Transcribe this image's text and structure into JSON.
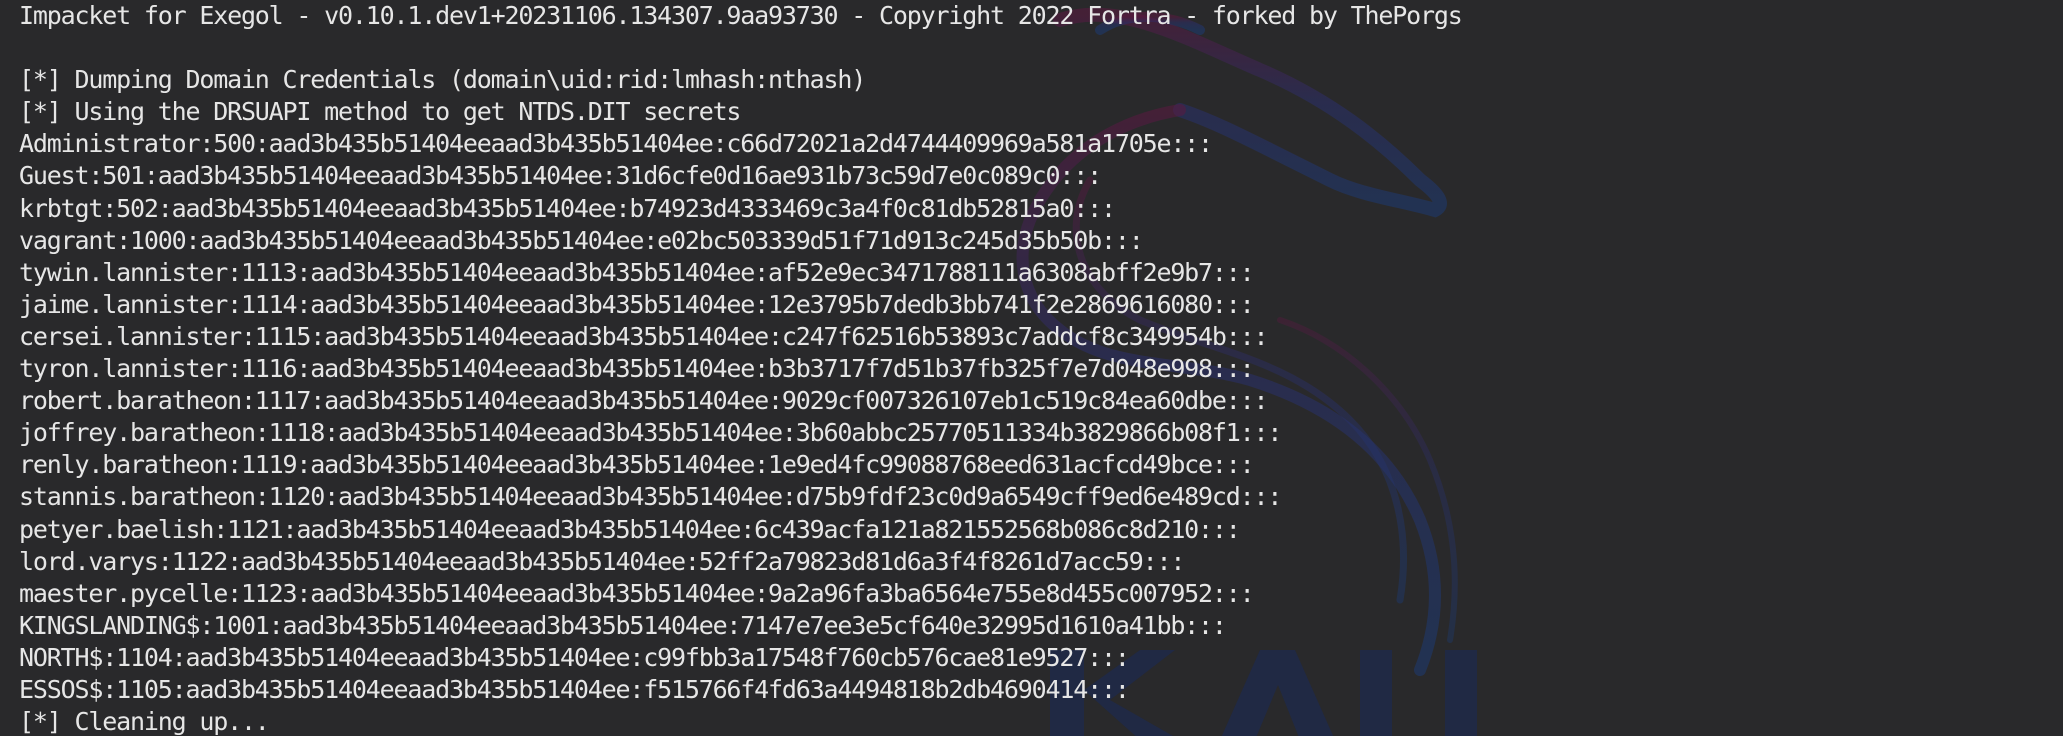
{
  "terminal": {
    "background_color": "#29292b",
    "text_color": "#e6e6e6",
    "wallpaper": "kali-dragon-logo",
    "wallpaper_text": "KALI",
    "lines": [
      "Impacket for Exegol - v0.10.1.dev1+20231106.134307.9aa93730 - Copyright 2022 Fortra - forked by ThePorgs",
      "",
      "[*] Dumping Domain Credentials (domain\\uid:rid:lmhash:nthash)",
      "[*] Using the DRSUAPI method to get NTDS.DIT secrets",
      "Administrator:500:aad3b435b51404eeaad3b435b51404ee:c66d72021a2d4744409969a581a1705e:::",
      "Guest:501:aad3b435b51404eeaad3b435b51404ee:31d6cfe0d16ae931b73c59d7e0c089c0:::",
      "krbtgt:502:aad3b435b51404eeaad3b435b51404ee:b74923d4333469c3a4f0c81db52815a0:::",
      "vagrant:1000:aad3b435b51404eeaad3b435b51404ee:e02bc503339d51f71d913c245d35b50b:::",
      "tywin.lannister:1113:aad3b435b51404eeaad3b435b51404ee:af52e9ec3471788111a6308abff2e9b7:::",
      "jaime.lannister:1114:aad3b435b51404eeaad3b435b51404ee:12e3795b7dedb3bb741f2e2869616080:::",
      "cersei.lannister:1115:aad3b435b51404eeaad3b435b51404ee:c247f62516b53893c7addcf8c349954b:::",
      "tyron.lannister:1116:aad3b435b51404eeaad3b435b51404ee:b3b3717f7d51b37fb325f7e7d048e998:::",
      "robert.baratheon:1117:aad3b435b51404eeaad3b435b51404ee:9029cf007326107eb1c519c84ea60dbe:::",
      "joffrey.baratheon:1118:aad3b435b51404eeaad3b435b51404ee:3b60abbc25770511334b3829866b08f1:::",
      "renly.baratheon:1119:aad3b435b51404eeaad3b435b51404ee:1e9ed4fc99088768eed631acfcd49bce:::",
      "stannis.baratheon:1120:aad3b435b51404eeaad3b435b51404ee:d75b9fdf23c0d9a6549cff9ed6e489cd:::",
      "petyer.baelish:1121:aad3b435b51404eeaad3b435b51404ee:6c439acfa121a821552568b086c8d210:::",
      "lord.varys:1122:aad3b435b51404eeaad3b435b51404ee:52ff2a79823d81d6a3f4f8261d7acc59:::",
      "maester.pycelle:1123:aad3b435b51404eeaad3b435b51404ee:9a2a96fa3ba6564e755e8d455c007952:::",
      "KINGSLANDING$:1001:aad3b435b51404eeaad3b435b51404ee:7147e7ee3e5cf640e32995d1610a41bb:::",
      "NORTH$:1104:aad3b435b51404eeaad3b435b51404ee:c99fbb3a17548f760cb576cae81e9527:::",
      "ESSOS$:1105:aad3b435b51404eeaad3b435b51404ee:f515766f4fd63a4494818b2db4690414:::",
      "[*] Cleaning up..."
    ]
  }
}
